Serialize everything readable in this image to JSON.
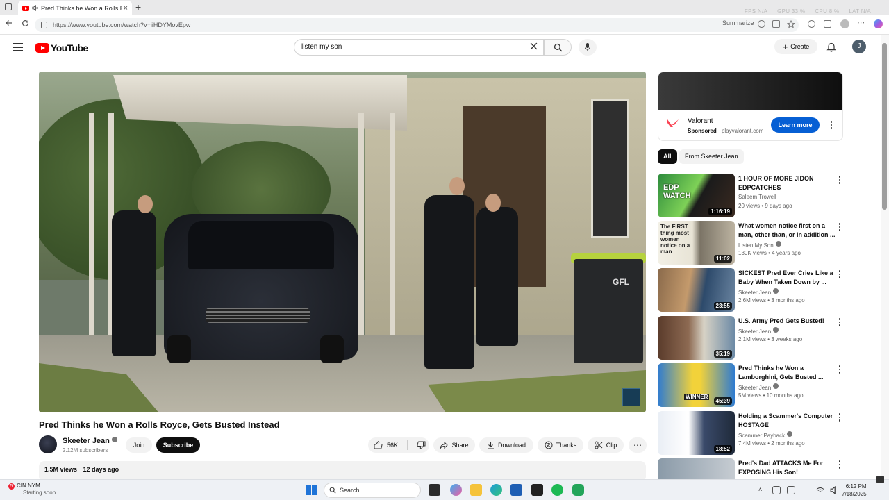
{
  "browser": {
    "tab_title": "Pred Thinks he Won a Rolls R",
    "new_tab_symbol": "+",
    "close_symbol": "×",
    "url": "https://www.youtube.com/watch?v=iiHDYMovEpw",
    "summarize_label": "Summarize",
    "perf": [
      {
        "label": "FPS",
        "value": "N/A"
      },
      {
        "label": "GPU",
        "value": "33 %"
      },
      {
        "label": "CPU",
        "value": "8 %"
      },
      {
        "label": "LAT",
        "value": "N/A"
      }
    ]
  },
  "header": {
    "logo_text": "YouTube",
    "search_value": "listen my son",
    "create_label": "Create",
    "avatar_letter": "J"
  },
  "video": {
    "title": "Pred Thinks he Won a Rolls Royce, Gets Busted Instead",
    "watermark_text": "GFL",
    "channel_name": "Skeeter Jean",
    "subscribers": "2.12M subscribers",
    "join_label": "Join",
    "subscribe_label": "Subscribe",
    "likes": "56K",
    "share_label": "Share",
    "download_label": "Download",
    "thanks_label": "Thanks",
    "clip_label": "Clip",
    "views": "1.5M views",
    "age": "12 days ago"
  },
  "ad": {
    "name": "Valorant",
    "sponsored_label": "Sponsored",
    "domain": "playvalorant.com",
    "cta_label": "Learn more"
  },
  "chips": [
    "All",
    "From Skeeter Jean"
  ],
  "recommendations": [
    {
      "title": "1 HOUR OF MORE JIDON EDPCATCHES",
      "channel": "Saleem Trowell",
      "views": "20 views",
      "age": "9 days ago",
      "duration": "1:16:19",
      "thumb_text": "EDP WATCH",
      "verified": false
    },
    {
      "title": "What women notice first on a man, other than, or in addition ...",
      "channel": "Listen My Son",
      "views": "130K views",
      "age": "4 years ago",
      "duration": "11:02",
      "thumb_text": "The FIRST thing most women notice on a man",
      "verified": true
    },
    {
      "title": "SICKEST Pred Ever Cries Like a Baby When Taken Down by ...",
      "channel": "Skeeter Jean",
      "views": "2.6M views",
      "age": "3 months ago",
      "duration": "23:55",
      "thumb_text": "",
      "verified": true
    },
    {
      "title": "U.S. Army Pred Gets Busted!",
      "channel": "Skeeter Jean",
      "views": "2.1M views",
      "age": "3 weeks ago",
      "duration": "35:19",
      "thumb_text": "",
      "verified": true
    },
    {
      "title": "Pred Thinks he Won a Lamborghini, Gets Busted ...",
      "channel": "Skeeter Jean",
      "views": "5M views",
      "age": "10 months ago",
      "duration": "45:39",
      "thumb_text": "WINNER",
      "verified": true
    },
    {
      "title": "Holding a Scammer's Computer HOSTAGE",
      "channel": "Scammer Payback",
      "views": "7.4M views",
      "age": "2 months ago",
      "duration": "18:52",
      "thumb_text": "",
      "verified": true
    },
    {
      "title": "Pred's Dad ATTACKS Me For EXPOSING His Son!",
      "channel": "",
      "views": "",
      "age": "",
      "duration": "",
      "thumb_text": "",
      "verified": false
    }
  ],
  "taskbar": {
    "weather_label": "CIN  NYM",
    "weather_sub": "Starting soon",
    "weather_badge": "5",
    "search_label": "Search",
    "time": "6:12 PM",
    "date": "7/18/2025"
  },
  "colors": {
    "yt_red": "#ff0000",
    "cta_blue": "#065fd4",
    "valorant_red": "#fa4454",
    "subscribe_black": "#0f0f0f"
  }
}
